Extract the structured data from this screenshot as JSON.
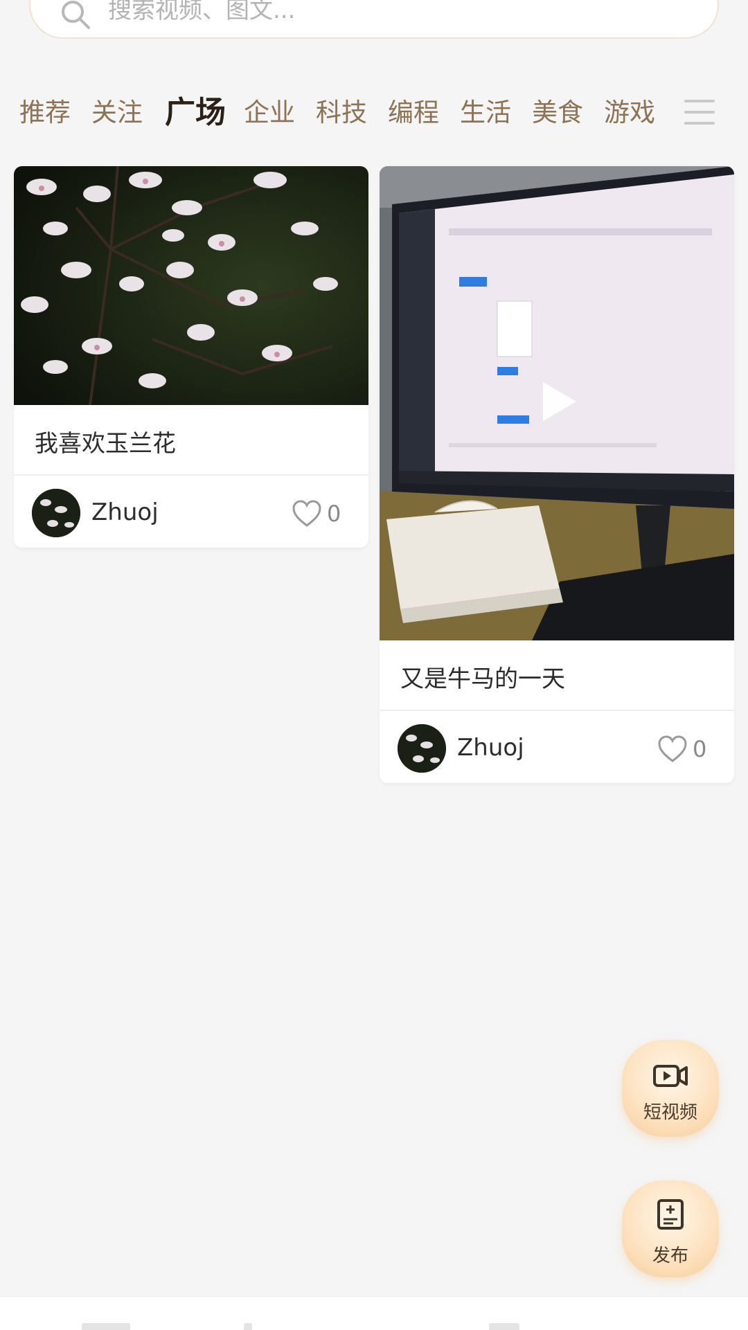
{
  "search": {
    "placeholder": "搜索视频、图文..."
  },
  "tabs": [
    {
      "label": "推荐",
      "active": false
    },
    {
      "label": "关注",
      "active": false
    },
    {
      "label": "广场",
      "active": true
    },
    {
      "label": "企业",
      "active": false
    },
    {
      "label": "科技",
      "active": false
    },
    {
      "label": "编程",
      "active": false
    },
    {
      "label": "生活",
      "active": false
    },
    {
      "label": "美食",
      "active": false
    },
    {
      "label": "游戏",
      "active": false
    }
  ],
  "menu_icon": "hamburger-icon",
  "cards": [
    {
      "media_type": "image",
      "media_subject": "magnolia-blossoms",
      "title": "我喜欢玉兰花",
      "author": "Zhuoj",
      "likes": "0"
    },
    {
      "media_type": "video",
      "media_subject": "monitor-on-desk",
      "title": "又是牛马的一天",
      "author": "Zhuoj",
      "likes": "0"
    }
  ],
  "fabs": {
    "short_video": {
      "label": "短视频",
      "icon": "video-camera-icon"
    },
    "publish": {
      "label": "发布",
      "icon": "document-add-icon"
    }
  },
  "colors": {
    "background": "#f5f5f5",
    "tab_inactive": "#8c7355",
    "tab_active": "#2a2018",
    "fab_gradient_outer": "#f7cd9b"
  }
}
